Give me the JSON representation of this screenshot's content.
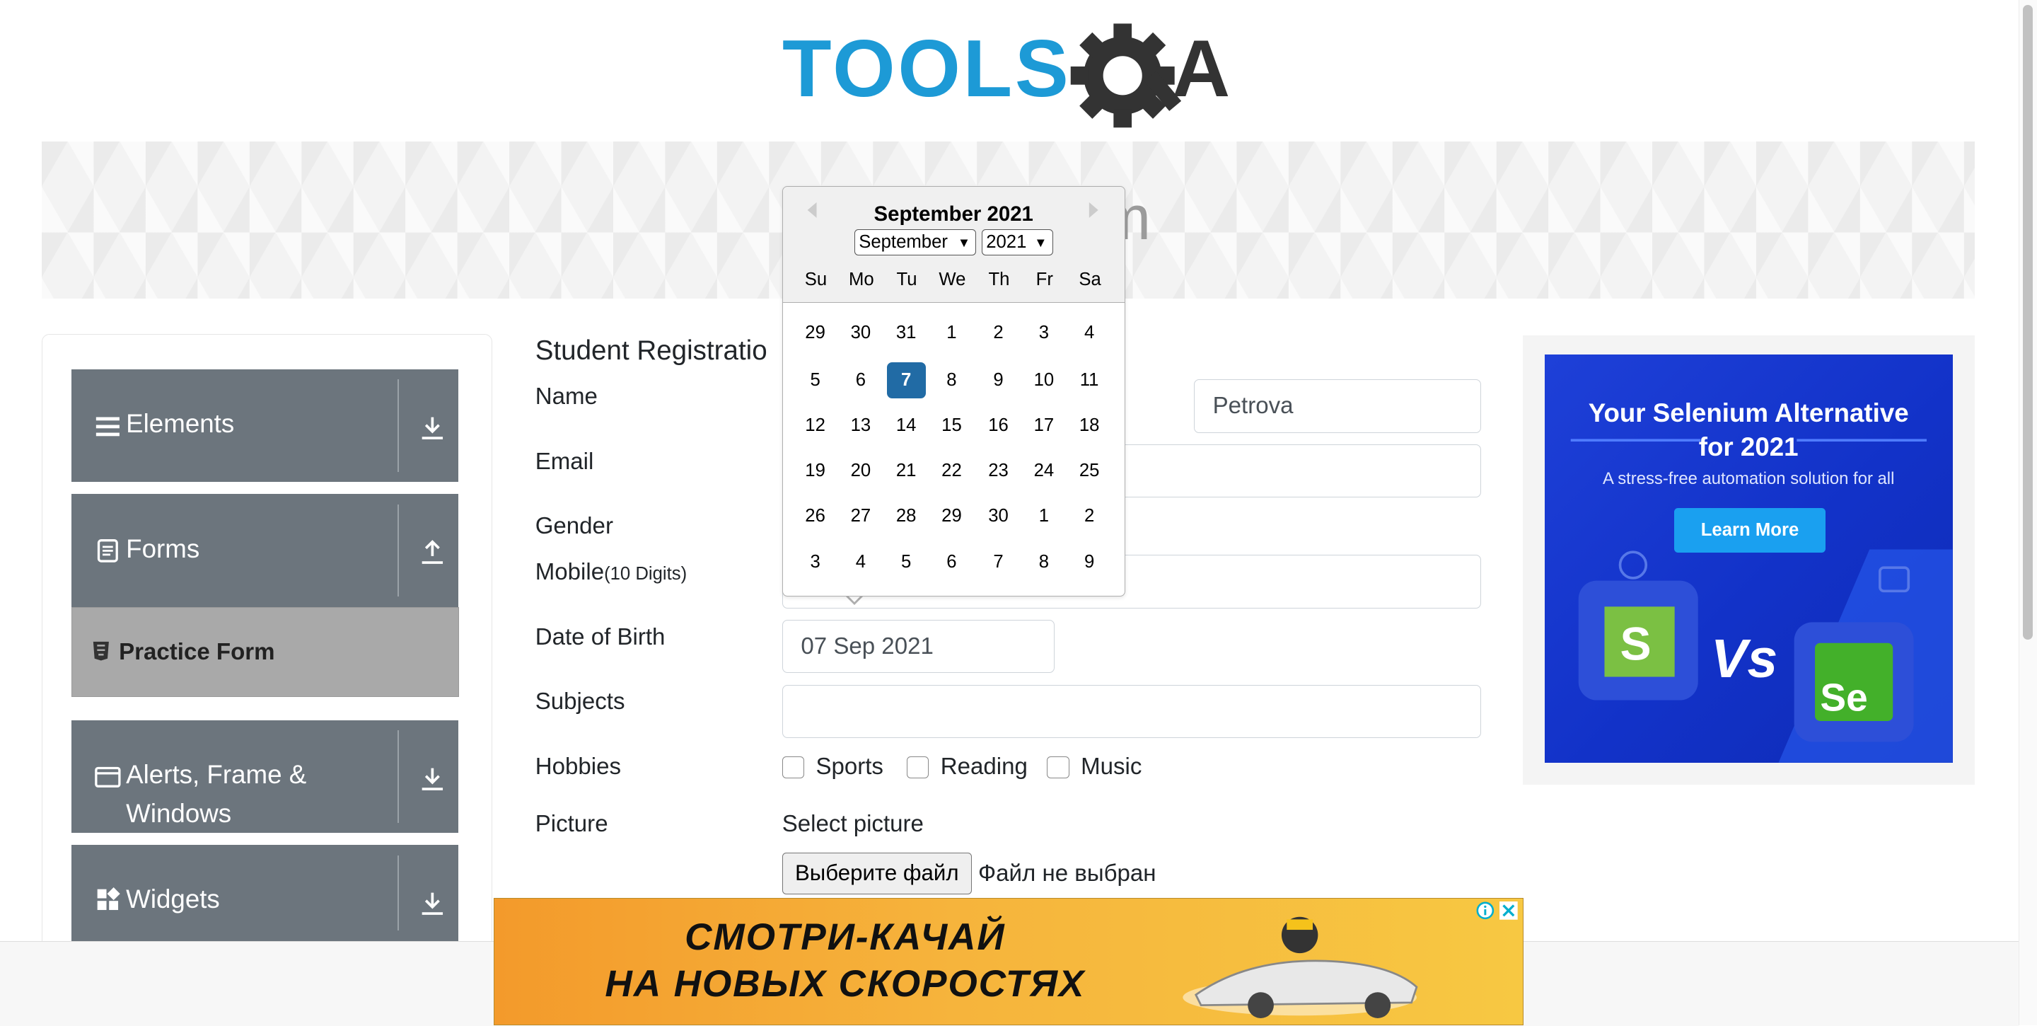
{
  "logo": {
    "text_left": "TOOLS",
    "text_right": "A",
    "text_gear": "Q"
  },
  "banner": {
    "title": "rm"
  },
  "sidebar": {
    "groups": [
      {
        "label": "Elements",
        "icon": "hamburger-icon",
        "arrow": "download-arrow-icon"
      },
      {
        "label": "Forms",
        "icon": "document-icon",
        "arrow": "upload-arrow-icon"
      },
      {
        "label": "Alerts, Frame &",
        "label2": "Windows",
        "icon": "window-icon",
        "arrow": "download-arrow-icon"
      },
      {
        "label": "Widgets",
        "icon": "widgets-icon",
        "arrow": "download-arrow-icon"
      }
    ],
    "active_item": {
      "label": "Practice Form",
      "icon": "html5-icon"
    }
  },
  "form": {
    "heading": "Student Registratio",
    "name_label": "Name",
    "last_name_value": "Petrova",
    "email_label": "Email",
    "gender_label": "Gender",
    "mobile_label": "Mobile",
    "mobile_hint": "(10 Digits)",
    "dob_label": "Date of Birth",
    "dob_value": "07 Sep 2021",
    "subjects_label": "Subjects",
    "hobbies_label": "Hobbies",
    "hobbies": [
      "Sports",
      "Reading",
      "Music"
    ],
    "picture_label": "Picture",
    "select_picture": "Select picture",
    "file_button": "Выберите файл",
    "file_status": "Файл не выбран"
  },
  "calendar": {
    "title": "September 2021",
    "month_select": "September",
    "year_select": "2021",
    "weekdays": [
      "Su",
      "Mo",
      "Tu",
      "We",
      "Th",
      "Fr",
      "Sa"
    ],
    "weeks": [
      [
        "29",
        "30",
        "31",
        "1",
        "2",
        "3",
        "4"
      ],
      [
        "5",
        "6",
        "7",
        "8",
        "9",
        "10",
        "11"
      ],
      [
        "12",
        "13",
        "14",
        "15",
        "16",
        "17",
        "18"
      ],
      [
        "19",
        "20",
        "21",
        "22",
        "23",
        "24",
        "25"
      ],
      [
        "26",
        "27",
        "28",
        "29",
        "30",
        "1",
        "2"
      ],
      [
        "3",
        "4",
        "5",
        "6",
        "7",
        "8",
        "9"
      ]
    ],
    "selected": "7"
  },
  "ad_right": {
    "title_line1": "Your Selenium Alternative",
    "title_line2": "for 2021",
    "subtitle": "A stress-free automation solution for all",
    "button": "Learn More",
    "vs": "Vs"
  },
  "ad_bottom": {
    "line1": "СМОТРИ-КАЧАЙ",
    "line2": "НА НОВЫХ СКОРОСТЯХ"
  },
  "colors": {
    "sidebar_group": "#6c757d",
    "active_item": "#a9a9a9",
    "calendar_selected": "#216ba5",
    "ad_right_bg": "#1a3ad0",
    "ad_bottom_bg": "#f6b43c",
    "logo_blue": "#1d9ad6",
    "logo_dark": "#333333"
  }
}
